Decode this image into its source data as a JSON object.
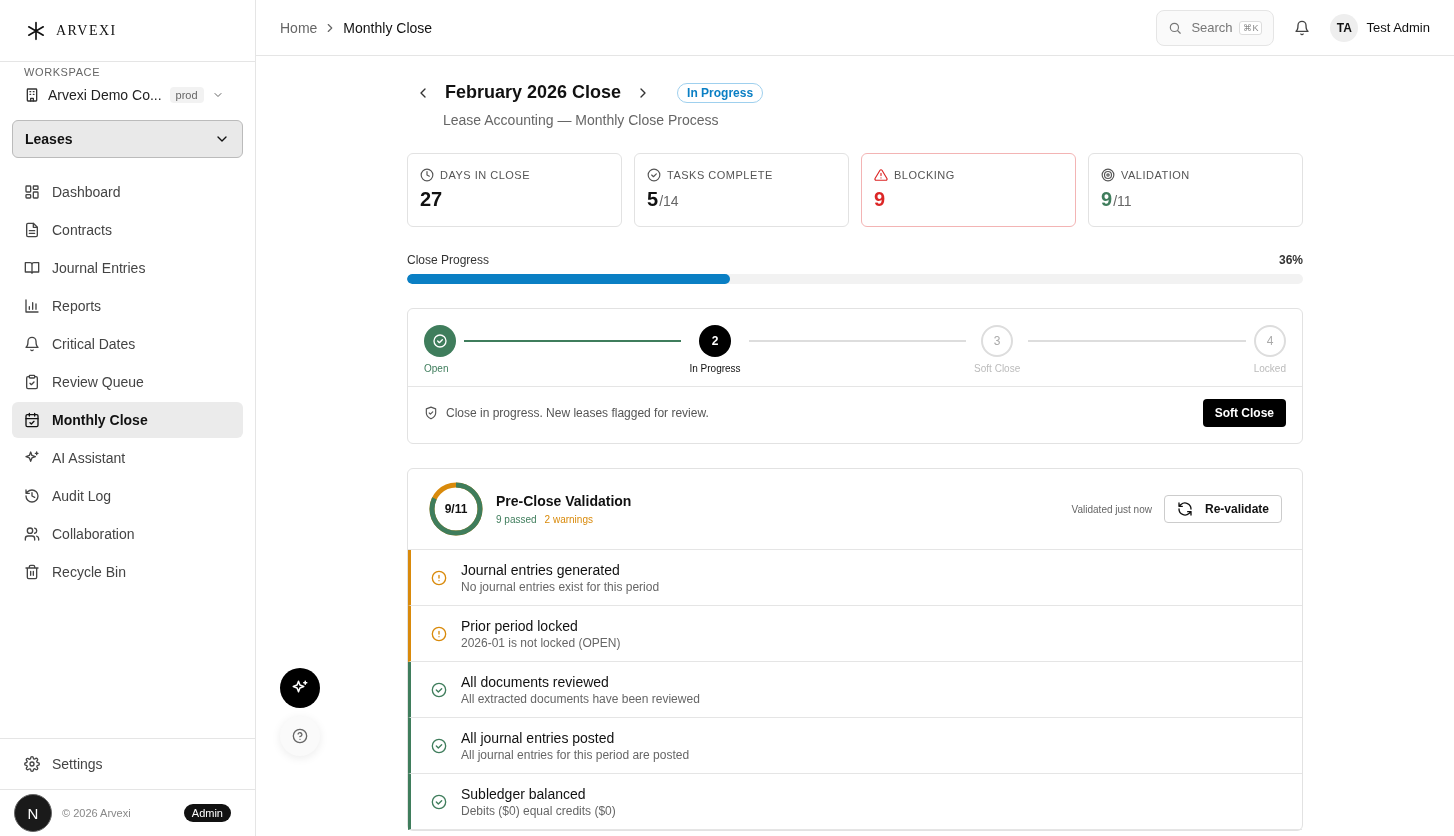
{
  "brand": {
    "name": "ARVEXI"
  },
  "workspace": {
    "label": "WORKSPACE",
    "name": "Arvexi Demo Co...",
    "badge": "prod"
  },
  "module_select": {
    "value": "Leases"
  },
  "nav": [
    {
      "label": "Dashboard",
      "selected": false
    },
    {
      "label": "Contracts",
      "selected": false
    },
    {
      "label": "Journal Entries",
      "selected": false
    },
    {
      "label": "Reports",
      "selected": false
    },
    {
      "label": "Critical Dates",
      "selected": false
    },
    {
      "label": "Review Queue",
      "selected": false
    },
    {
      "label": "Monthly Close",
      "selected": true
    },
    {
      "label": "AI Assistant",
      "selected": false
    },
    {
      "label": "Audit Log",
      "selected": false
    },
    {
      "label": "Collaboration",
      "selected": false
    },
    {
      "label": "Recycle Bin",
      "selected": false
    }
  ],
  "settings": {
    "label": "Settings"
  },
  "footer": {
    "copyright": "© 2026 Arvexi",
    "role": "Admin"
  },
  "floating": {
    "avatar": "N"
  },
  "breadcrumb": [
    "Home",
    "Monthly Close"
  ],
  "search": {
    "placeholder": "Search",
    "shortcut": "⌘K"
  },
  "user": {
    "initials": "TA",
    "name": "Test Admin"
  },
  "period": {
    "title": "February 2026 Close",
    "status": "In Progress",
    "subtitle": "Lease Accounting — Monthly Close Process"
  },
  "stats": [
    {
      "kind": "clock",
      "label": "DAYS IN CLOSE",
      "value": "27",
      "color": "#111111"
    },
    {
      "kind": "check",
      "label": "TASKS COMPLETE",
      "value": "5",
      "total": "/14",
      "color": "#111111"
    },
    {
      "kind": "warning",
      "label": "BLOCKING",
      "value": "9",
      "color": "#dc2626"
    },
    {
      "kind": "target",
      "label": "VALIDATION",
      "value": "9",
      "total": "/11",
      "color": "#3f7d5c"
    }
  ],
  "progress": {
    "label": "Close Progress",
    "reading": "36%",
    "level": 0.36
  },
  "stepper": {
    "steps": [
      {
        "label": "Open",
        "done": true,
        "selected": false
      },
      {
        "label": "In Progress",
        "number": "2",
        "done": false,
        "selected": true
      },
      {
        "label": "Soft Close",
        "number": "3",
        "done": false,
        "selected": false
      },
      {
        "label": "Locked",
        "number": "4",
        "done": false,
        "selected": false
      }
    ],
    "message": "Close in progress. New leases flagged for review.",
    "action": "Soft Close"
  },
  "validation": {
    "score": "9/11",
    "level": 0.818,
    "title": "Pre-Close Validation",
    "passed": "9 passed",
    "warnings": "2 warnings",
    "timestamp": "Validated just now",
    "action": "Re-validate",
    "checks": [
      {
        "kind": "warning",
        "title": "Journal entries generated",
        "detail": "No journal entries exist for this period"
      },
      {
        "kind": "warning",
        "title": "Prior period locked",
        "detail": "2026-01 is not locked (OPEN)"
      },
      {
        "kind": "pass",
        "title": "All documents reviewed",
        "detail": "All extracted documents have been reviewed"
      },
      {
        "kind": "pass",
        "title": "All journal entries posted",
        "detail": "All journal entries for this period are posted"
      },
      {
        "kind": "pass",
        "title": "Subledger balanced",
        "detail": "Debits ($0) equal credits ($0)"
      }
    ]
  }
}
